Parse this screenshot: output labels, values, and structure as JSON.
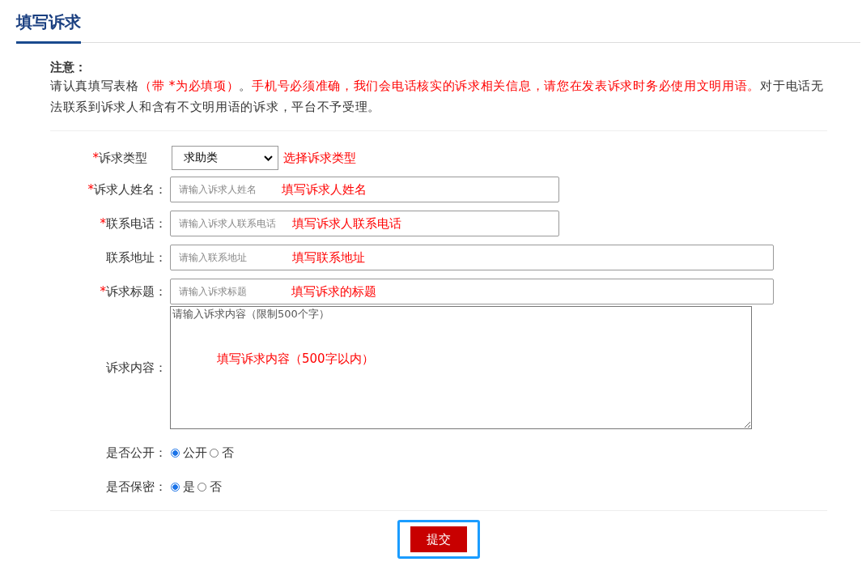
{
  "tab": {
    "title": "填写诉求",
    "selected": true
  },
  "notice": {
    "heading": "注意：",
    "segments": [
      {
        "text": "请认真填写表格",
        "emphasis": false
      },
      {
        "text": "（带 *为必填项）",
        "emphasis": true
      },
      {
        "text": "。",
        "emphasis": false
      },
      {
        "text": "手机号必须准确，我们会电话核实的诉求相关信息，请您在发表诉求时务必使用文明用语。",
        "emphasis": true
      },
      {
        "text": "对于电话无法联系到诉求人和含有不文明用语的诉求，平台不予受理。",
        "emphasis": false
      }
    ]
  },
  "fields": [
    {
      "kind": "select",
      "required_mark": "*",
      "label": "诉求类型",
      "value": "求助类",
      "hint": "选择诉求类型"
    },
    {
      "kind": "text",
      "wide": false,
      "required_mark": "*",
      "label": "诉求人姓名：",
      "placeholder": "请输入诉求人姓名",
      "hint": "填写诉求人姓名"
    },
    {
      "kind": "text",
      "wide": false,
      "required_mark": "*",
      "label": "联系电话：",
      "placeholder": "请输入诉求人联系电话",
      "hint": "填写诉求人联系电话"
    },
    {
      "kind": "text",
      "wide": true,
      "label": "联系地址：",
      "placeholder": "请输入联系地址",
      "hint": "填写联系地址"
    },
    {
      "kind": "text",
      "wide": true,
      "required_mark": "*",
      "label": "诉求标题：",
      "placeholder": "请输入诉求标题",
      "hint": "填写诉求的标题"
    },
    {
      "kind": "textarea",
      "label": "诉求内容：",
      "placeholder": "请输入诉求内容（限制500个字）",
      "hint": "填写诉求内容（500字以内）"
    },
    {
      "kind": "radio",
      "label": "是否公开：",
      "options": [
        {
          "label": "公开",
          "selected": true
        },
        {
          "label": "否",
          "selected": false
        }
      ]
    },
    {
      "kind": "radio",
      "label": "是否保密：",
      "options": [
        {
          "label": "是",
          "selected": true
        },
        {
          "label": "否",
          "selected": false
        }
      ]
    }
  ],
  "submit": {
    "label": "提交",
    "focused": true
  }
}
